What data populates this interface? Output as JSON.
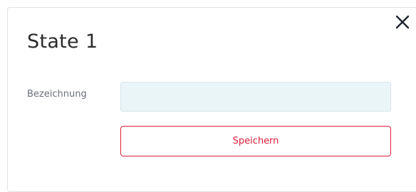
{
  "dialog": {
    "title": "State 1",
    "close_icon": "close-icon"
  },
  "form": {
    "name_label": "Bezeichnung",
    "name_value": "",
    "name_placeholder": "",
    "save_label": "Speichern"
  },
  "colors": {
    "accent": "#d8203c",
    "input_background": "#eaf5f7",
    "title_text": "#2b2b2b",
    "label_text": "#6b6f7a"
  }
}
